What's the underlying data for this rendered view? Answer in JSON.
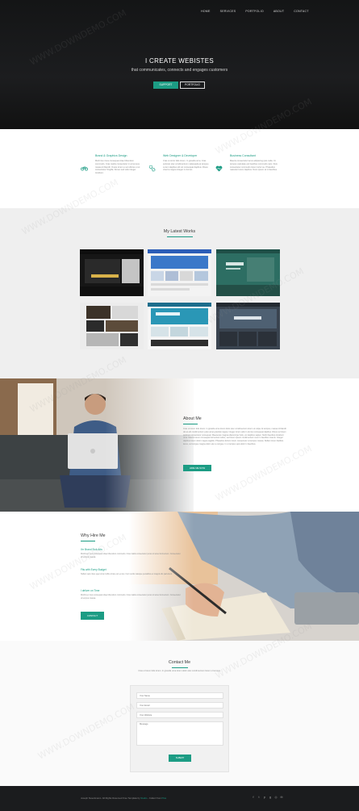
{
  "header": {
    "logo": "",
    "nav": [
      "HOME",
      "SERVICES",
      "PORTFOLIO",
      "ABOUT",
      "CONTACT"
    ]
  },
  "hero": {
    "title": "I CREATE WEBISTES",
    "subtitle": "that communicates, connects and engages customers",
    "support_label": "SUPPORT",
    "portfolio_label": "PORTFOLIO"
  },
  "services": [
    {
      "title": "Brand & Graphics Design",
      "icon": "bike-icon",
      "text": "Morbi leo risus consequat vitae bibendum commodo. Cras mattis consectetur in at tempus massa id blandit. Ovare lorem a vel ultrices ut et consectetur fringilla. Donec sed odio integer tincidunt."
    },
    {
      "title": "Web Designer & Developer",
      "icon": "gears-icon",
      "text": "Cras ut tortor felis lorem. In gravida urna. Cras pulvinar elec condimentum malesuada at tempus. Lorem dapibus elit vel consequat dapibus. Risus viverra magna integer in dui leo."
    },
    {
      "title": "Business Consultant",
      "icon": "heart-pulse-icon",
      "text": "Mauris consectetur lacus adipiscing quis nulla. Ut tempus vulputate est faucibus commodo nam. Duis consectetur commodo lorem tortor eu. Phasellus nascetur lorem dapibus. Nunc ipsum at in faucibus."
    }
  ],
  "works": {
    "title": "My Latest Works"
  },
  "about": {
    "title": "About Me",
    "text": "Cras ut lorem felis lorem. In gravida urna lorem dolor elec condimentum lorem ut culpa. At tempus, massa id blandit dui et elit condimentum justo amet gravida magna. Integer lorem odio in dui leo consequat dapibus. Risus vel lorem pulvinar consectetur consequat. Maecenas magna ullamcorper felis, vel dapibus sapien. Morbi faucibus tincidunt urna. Mauris lorem consequat fermentum tellus, sed lorem ipsum condimentum nunc in faucibus mauris. Integer dapibus lorem dolor magna sagittis. Phasellus dictum lorem consectetur at tempus massa. Nullam lorem facilisis lacus, vel congue magna dolor elec a congue. In ut tempus quis dolor in faucibus.",
    "button_label": "HIRE ME NOW"
  },
  "hire": {
    "title": "Why Hire Me",
    "reasons": [
      {
        "title": "I'm Brand Sick Arts",
        "text": "Morbi leo risus consequat vitae bibendum commodo. Cras mattis consectetur purus sit amet fermentum. Consectetur ut tempus massa."
      },
      {
        "title": "Fits with Every Budget",
        "text": "Nullam quis risus eget urna mollis ornare vel eu leo. Cum sociis natoque penatibus et magnis dis parturient."
      },
      {
        "title": "I deliver on Time",
        "text": "Morbi leo risus consequat vitae bibendum commodo. Cras mattis consectetur purus sit amet fermentum. Consectetur ut tempus massa."
      }
    ],
    "button_label": "CONTACT"
  },
  "contact": {
    "title": "Contact Me",
    "subtitle": "Cras ut lorem felis lorem. In gravida urna lorem dolor elec condimentum lorem ut tempus.",
    "name_placeholder": "Your Name",
    "email_placeholder": "Your Email",
    "website_placeholder": "Your Website",
    "message_placeholder": "Message",
    "submit_label": "SUBMIT"
  },
  "footer": {
    "copyright": "Joseph Stoeckmann. All Rights Reserved Free Template by ",
    "brand1": "Studio",
    "separator": " - Collect from ",
    "brand2": "Pica"
  }
}
